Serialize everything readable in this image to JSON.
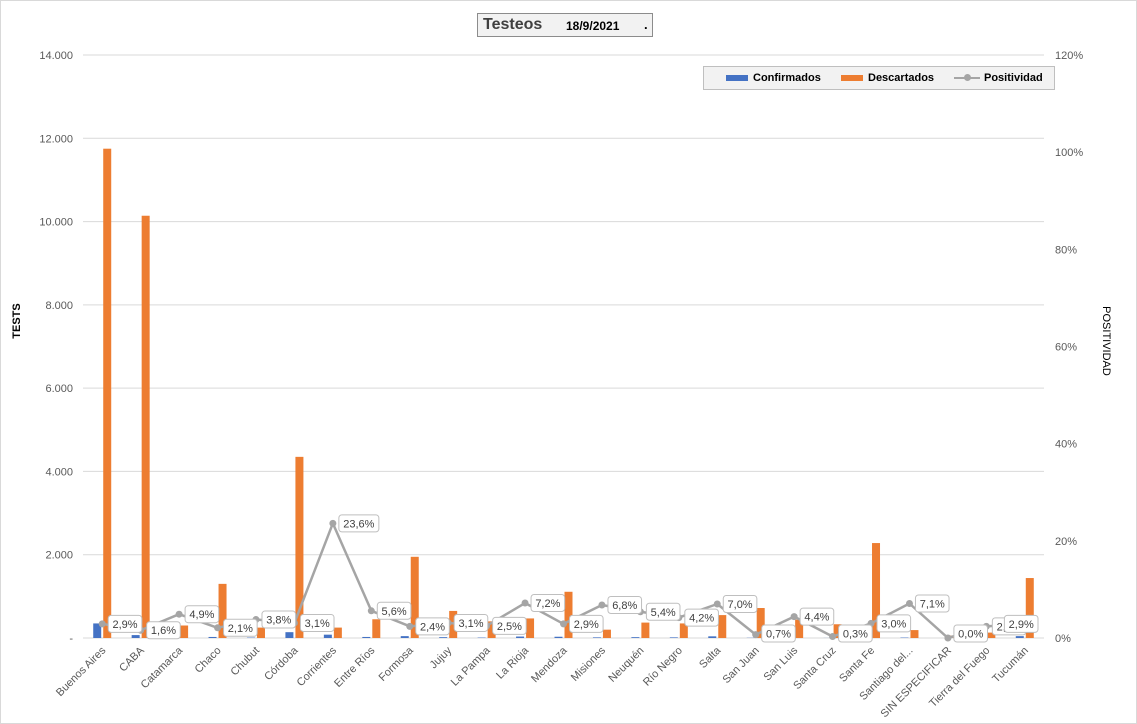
{
  "chart_data": {
    "type": "bar",
    "title": "Testeos",
    "date": "18/9/2021",
    "title_suffix": ".",
    "ylabel": "TESTS",
    "y2label": "POSITIVIDAD",
    "ylim": [
      0,
      14000
    ],
    "y2lim": [
      0,
      120
    ],
    "yticks": [
      "-",
      "2.000",
      "4.000",
      "6.000",
      "8.000",
      "10.000",
      "12.000",
      "14.000"
    ],
    "y2ticks": [
      "0%",
      "20%",
      "40%",
      "60%",
      "80%",
      "100%",
      "120%"
    ],
    "grid": true,
    "legend_position": "top-right",
    "colors": {
      "Confirmados": "#4472c4",
      "Descartados": "#ed7d31",
      "Positividad": "#a5a5a5"
    },
    "categories": [
      "Buenos Aires",
      "CABA",
      "Catamarca",
      "Chaco",
      "Chubut",
      "Córdoba",
      "Corrientes",
      "Entre Ríos",
      "Formosa",
      "Jujuy",
      "La Pampa",
      "La Rioja",
      "Mendoza",
      "Misiones",
      "Neuquén",
      "Río Negro",
      "Salta",
      "San Juan",
      "San Luis",
      "Santa Cruz",
      "Santa Fe",
      "Santiago del...",
      "SIN ESPECIFICAR",
      "Tierra del Fuego",
      "Tucumán"
    ],
    "series": [
      {
        "name": "Confirmados",
        "type": "bar",
        "axis": "left",
        "values": [
          350,
          70,
          15,
          25,
          10,
          140,
          80,
          25,
          45,
          20,
          10,
          35,
          30,
          15,
          20,
          15,
          40,
          5,
          20,
          2,
          70,
          10,
          0,
          5,
          45
        ]
      },
      {
        "name": "Descartados",
        "type": "bar",
        "axis": "left",
        "values": [
          11750,
          10140,
          300,
          1300,
          250,
          4350,
          250,
          450,
          1950,
          650,
          400,
          470,
          1110,
          200,
          370,
          350,
          550,
          720,
          440,
          330,
          2280,
          190,
          60,
          130,
          1440
        ]
      },
      {
        "name": "Positividad",
        "type": "line",
        "axis": "right",
        "values": [
          2.9,
          1.6,
          4.9,
          2.1,
          3.8,
          3.1,
          23.6,
          5.6,
          2.4,
          3.1,
          2.5,
          7.2,
          2.9,
          6.8,
          5.4,
          4.2,
          7.0,
          0.7,
          4.4,
          0.3,
          3.0,
          7.1,
          0.0,
          2.4,
          2.9
        ],
        "labels": [
          "2,9%",
          "1,6%",
          "4,9%",
          "2,1%",
          "3,8%",
          "3,1%",
          "23,6%",
          "5,6%",
          "2,4%",
          "3,1%",
          "2,5%",
          "7,2%",
          "2,9%",
          "6,8%",
          "5,4%",
          "4,2%",
          "7,0%",
          "0,7%",
          "4,4%",
          "0,3%",
          "3,0%",
          "7,1%",
          "0,0%",
          "2,4%",
          "2,9%"
        ]
      }
    ]
  }
}
